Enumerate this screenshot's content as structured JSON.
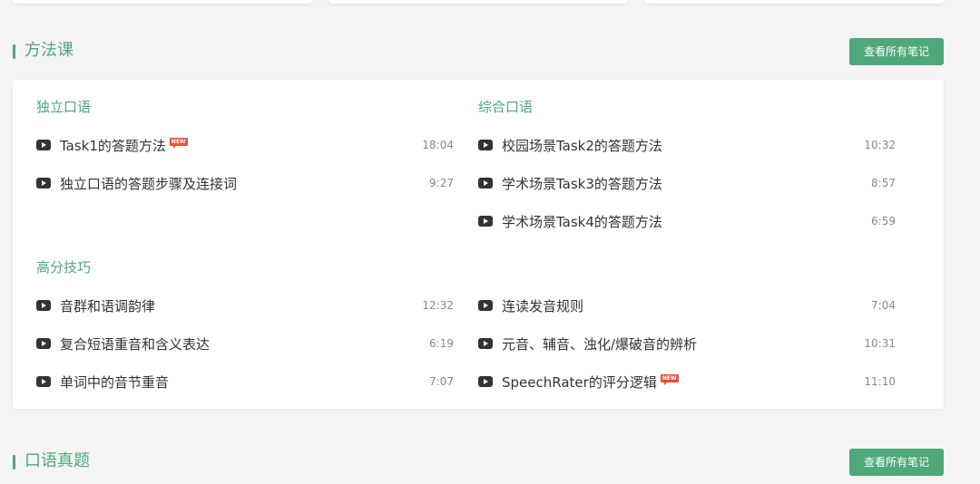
{
  "sections": [
    {
      "title": "方法课",
      "notes_label": "查看所有笔记"
    },
    {
      "title": "口语真题",
      "notes_label": "查看所有笔记"
    }
  ],
  "groups": {
    "independent": {
      "title": "独立口语",
      "lessons": [
        {
          "title": "Task1的答题方法",
          "duration": "18:04",
          "badge": "NEW"
        },
        {
          "title": "独立口语的答题步骤及连接词",
          "duration": "9:27"
        }
      ]
    },
    "integrated": {
      "title": "综合口语",
      "lessons": [
        {
          "title": "校园场景Task2的答题方法",
          "duration": "10:32"
        },
        {
          "title": "学术场景Task3的答题方法",
          "duration": "8:57"
        },
        {
          "title": "学术场景Task4的答题方法",
          "duration": "6:59"
        }
      ]
    },
    "skills": {
      "title": "高分技巧",
      "lessons_left": [
        {
          "title": "音群和语调韵律",
          "duration": "12:32"
        },
        {
          "title": "复合短语重音和含义表达",
          "duration": "6:19"
        },
        {
          "title": "单词中的音节重音",
          "duration": "7:07"
        }
      ],
      "lessons_right": [
        {
          "title": "连读发音规则",
          "duration": "7:04"
        },
        {
          "title": "元音、辅音、浊化/爆破音的辨析",
          "duration": "10:31"
        },
        {
          "title": "SpeechRater的评分逻辑",
          "duration": "11:10",
          "badge": "NEW"
        }
      ]
    }
  },
  "colors": {
    "accent": "#4fa87a",
    "badge": "#e4553b"
  },
  "icons": {
    "lesson": "play-video-icon"
  }
}
